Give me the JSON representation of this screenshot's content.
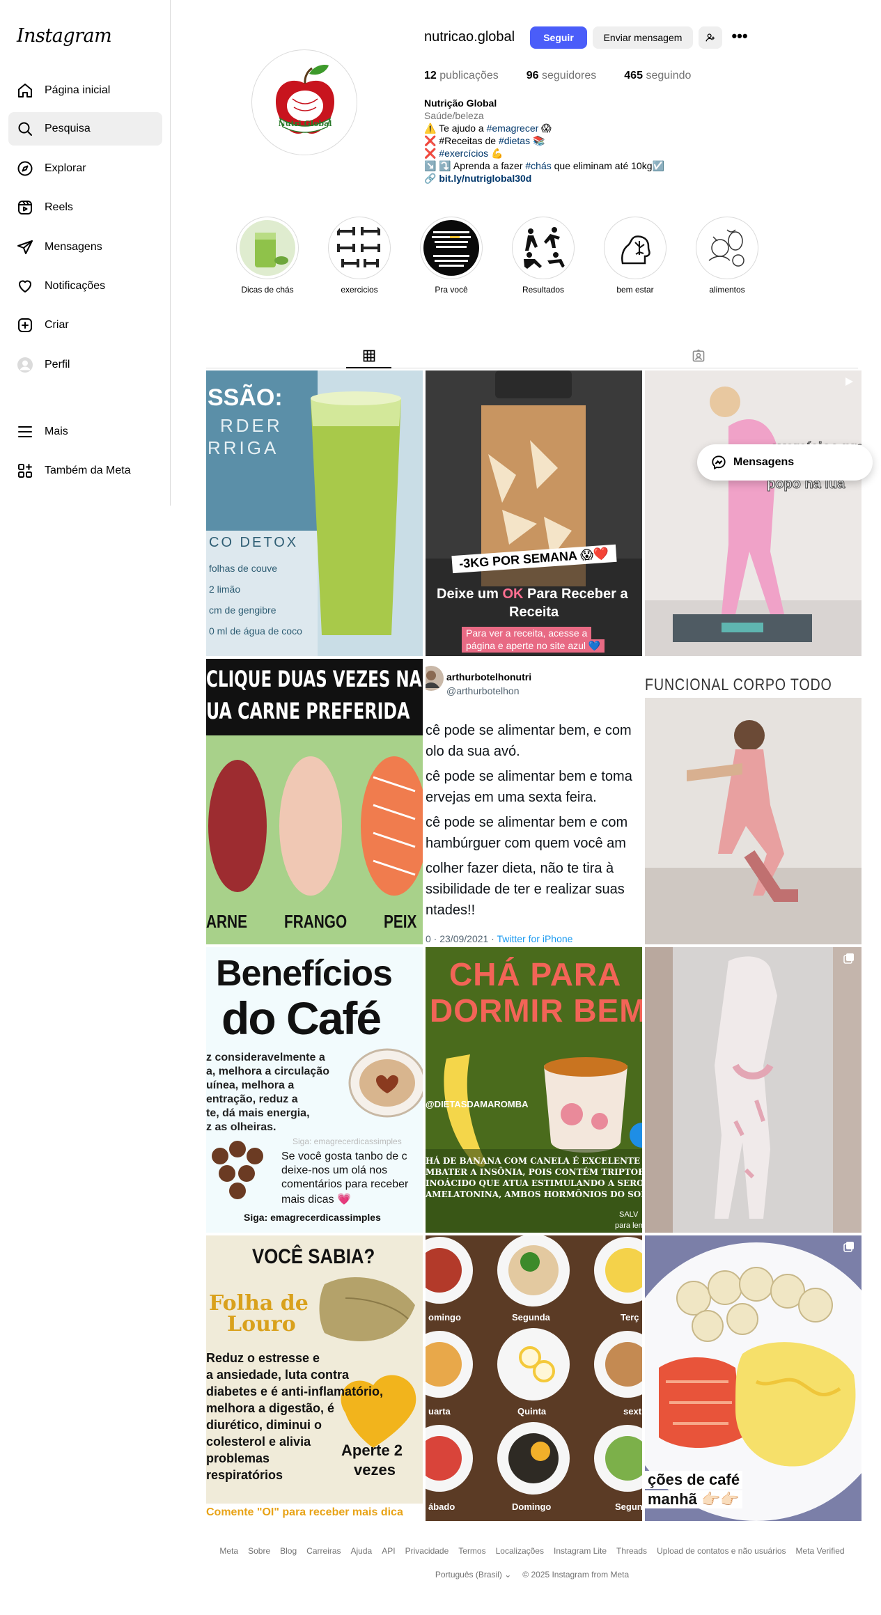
{
  "sidebar": {
    "logo": "Instagram",
    "items": [
      {
        "label": "Página inicial"
      },
      {
        "label": "Pesquisa"
      },
      {
        "label": "Explorar"
      },
      {
        "label": "Reels"
      },
      {
        "label": "Mensagens"
      },
      {
        "label": "Notificações"
      },
      {
        "label": "Criar"
      },
      {
        "label": "Perfil"
      },
      {
        "label": "Mais"
      },
      {
        "label": "Também da Meta"
      }
    ]
  },
  "profile": {
    "username": "nutricao.global",
    "follow_label": "Seguir",
    "message_label": "Enviar mensagem",
    "more_label": "•••",
    "avatar_text": "Nutri Global",
    "stats": {
      "posts_count": "12",
      "posts_label": "publicações",
      "followers_count": "96",
      "followers_label": "seguidores",
      "following_count": "465",
      "following_label": "seguindo"
    },
    "bio": {
      "name": "Nutrição Global",
      "category": "Saúde/beleza",
      "line1_pre": "⚠️ Te ajudo a ",
      "line1_tag": "#emagrecer",
      "line1_post": " 😱",
      "line2_pre": "❌ #Receitas de ",
      "line2_tag": "#dietas",
      "line2_post": " 📚",
      "line3_pre": "❌ ",
      "line3_tag": "#exercícios",
      "line3_post": " 💪",
      "line4_pre": "↘️ ⤵️ Aprenda a fazer ",
      "line4_tag": "#chás",
      "line4_post": " que eliminam até 10kg☑️",
      "link_icon": "🔗",
      "link": "bit.ly/nutriglobal30d"
    }
  },
  "highlights": [
    {
      "label": "Dicas de chás"
    },
    {
      "label": "exercicios"
    },
    {
      "label": "Pra você"
    },
    {
      "label": "Resultados"
    },
    {
      "label": "bem estar"
    },
    {
      "label": "alimentos"
    }
  ],
  "posts": {
    "p1": {
      "title_a": "SSÃO:",
      "title_b": "RDER",
      "title_c": "RRIGA",
      "sub": "CO DETOX",
      "l1": "folhas de couve",
      "l2": "2 limão",
      "l3": "cm de gengibre",
      "l4": "0 ml de água de coco"
    },
    "p2": {
      "tag": "-3KG POR SEMANA 😱❤️",
      "l1_pre": "Deixe um ",
      "l1_ok": "OK",
      "l1_post": " Para Receber a",
      "l2": "Receita",
      "l3": "Para ver a receita, acesse a",
      "l4": "página e aperte no site azul 💙"
    },
    "p3": {
      "l1": "exercícios pra",
      "l2": "popô na lua"
    },
    "p4": {
      "l1": "CLIQUE DUAS VEZES NA",
      "l2": "UA CARNE PREFERIDA",
      "c1": "ARNE",
      "c2": "FRANGO",
      "c3": "PEIX"
    },
    "p5": {
      "name": "arthurbotelhonutri",
      "handle": "@arthurbotelhon",
      "t1": "cê pode se alimentar bem, e com",
      "t2": "olo da sua avó.",
      "t3": "cê pode se alimentar bem e toma",
      "t4": "ervejas em uma sexta feira.",
      "t5": "cê pode se alimentar bem e com",
      "t6": "hambúrguer com quem você am",
      "t7": "colher fazer dieta, não te tira à",
      "t8": "ssibilidade de ter e realizar suas",
      "t9": "ntades!!",
      "footer_a": "0 · 23/09/2021 · ",
      "footer_b": "Twitter for iPhone"
    },
    "p6": {
      "title": "FUNCIONAL CORPO TODO"
    },
    "p7": {
      "t1": "Benefícios",
      "t2": "do Café",
      "l1": "z consideravelmente a",
      "l2": "a, melhora a circulação",
      "l3": "uínea, melhora a",
      "l4": "entração, reduz a",
      "l5": "te, dá mais energia,",
      "l6": "z as olheiras.",
      "siga1": "Siga: emagrecerdicassimples",
      "c1": "Se você gosta tanbo de c",
      "c2": "deixe-nos um olá nos",
      "c3": "comentários para receber",
      "c4": "mais dicas 💗",
      "siga2": "Siga: emagrecerdicassimples"
    },
    "p8": {
      "t1": "CHÁ PARA",
      "t2": "DORMIR BEM",
      "handle": "@DIETASDAMAROMBA",
      "b1": "HÁ DE BANANA COM CANELA É EXCELENTE PA",
      "b2": "MBATER A INSÔNIA, POIS CONTÉM TRIPTOFA",
      "b3": "INOÁCIDO QUE ATUA ESTIMULANDO A SEROT",
      "b4": "AMELATONINA, AMBOS HORMÔNIOS DO SONO",
      "salve": "SALV",
      "para": "para lem"
    },
    "p10": {
      "t1": "VOCÊ SABIA?",
      "t2": "Folha de",
      "t3": "Louro",
      "l1": "Reduz o estresse e",
      "l2": "a ansiedade, luta contra",
      "l3": "diabetes e é anti-inflamatório,",
      "l4": "melhora a digestão, é",
      "l5": "diurético, diminui o",
      "l6": "colesterol e alivia",
      "l7": "problemas",
      "l8": "respiratórios",
      "heart1": "Aperte 2",
      "heart2": "vezes",
      "bottom": "Comente \"OI\" para receber mais dica"
    },
    "p11": {
      "d1": "omingo",
      "d2": "Segunda",
      "d3": "Terç",
      "d4": "uarta",
      "d5": "Quinta",
      "d6": "sext",
      "d7": "ábado",
      "d8": "Domingo",
      "d9": "Segun"
    },
    "p12": {
      "l1": "ções de café",
      "l2": "manhã 👉🏻👉🏻"
    }
  },
  "floating": {
    "label": "Mensagens"
  },
  "footer": {
    "links": [
      "Meta",
      "Sobre",
      "Blog",
      "Carreiras",
      "Ajuda",
      "API",
      "Privacidade",
      "Termos",
      "Localizações",
      "Instagram Lite",
      "Threads",
      "Upload de contatos e não usuários",
      "Meta Verified"
    ],
    "language": "Português (Brasil)",
    "copyright": "© 2025 Instagram from Meta"
  },
  "colors": {
    "accent": "#4a5df9",
    "link": "#00376b",
    "muted": "#737373"
  }
}
